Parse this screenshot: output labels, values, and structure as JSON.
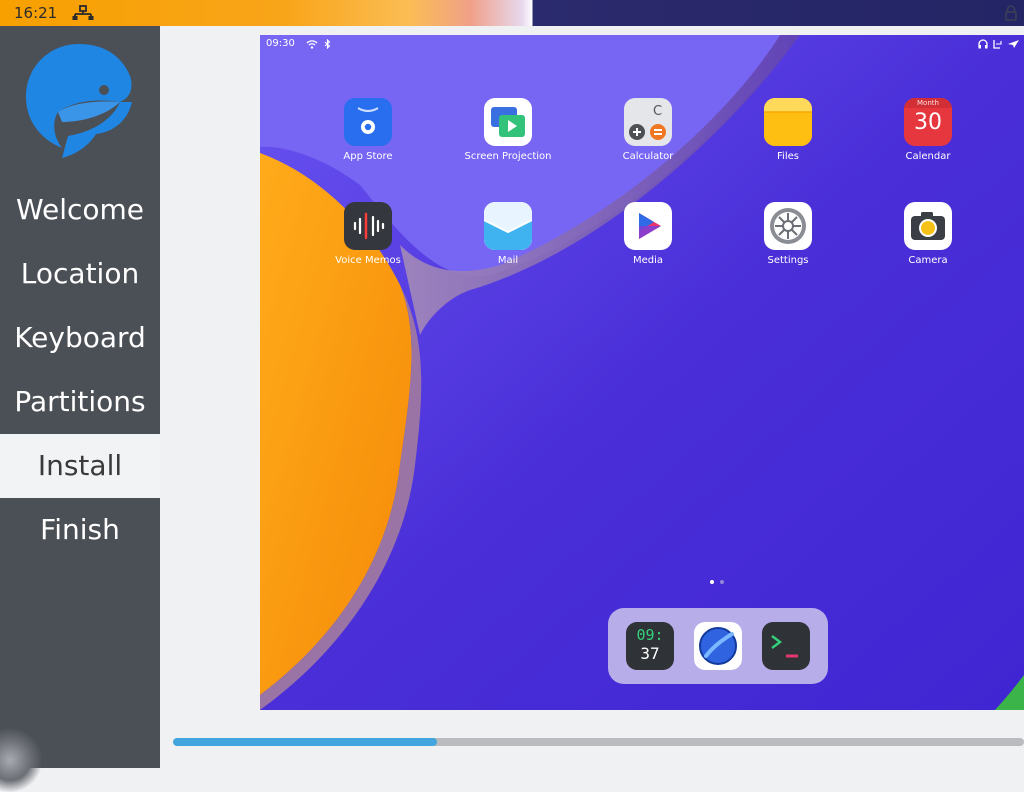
{
  "topbar": {
    "clock": "16:21",
    "network_icon": "network-wired-icon",
    "lock_icon": "lock-icon"
  },
  "sidebar": {
    "logo_icon": "fish-logo-icon",
    "items": [
      {
        "label": "Welcome",
        "active": false
      },
      {
        "label": "Location",
        "active": false
      },
      {
        "label": "Keyboard",
        "active": false
      },
      {
        "label": "Partitions",
        "active": false
      },
      {
        "label": "Install",
        "active": true
      },
      {
        "label": "Finish",
        "active": false
      }
    ]
  },
  "slideshow": {
    "status_time": "09:30",
    "apps": [
      {
        "label": "App Store",
        "icon": "app-store-icon"
      },
      {
        "label": "Screen Projection",
        "icon": "screen-projection-icon"
      },
      {
        "label": "Calculator",
        "icon": "calculator-icon"
      },
      {
        "label": "Files",
        "icon": "files-icon"
      },
      {
        "label": "Calendar",
        "icon": "calendar-icon",
        "month": "Month",
        "day": "30"
      },
      {
        "label": "Voice Memos",
        "icon": "voice-memos-icon"
      },
      {
        "label": "Mail",
        "icon": "mail-icon"
      },
      {
        "label": "Media",
        "icon": "media-icon"
      },
      {
        "label": "Settings",
        "icon": "settings-icon"
      },
      {
        "label": "Camera",
        "icon": "camera-icon"
      }
    ],
    "dock": [
      {
        "icon": "clock-icon",
        "hours": "09:",
        "minutes": "37"
      },
      {
        "icon": "browser-icon"
      },
      {
        "icon": "terminal-icon",
        "prompt": ">_"
      }
    ],
    "page_count": 2,
    "current_page": 1
  },
  "progress": {
    "value": 0.31
  },
  "colors": {
    "sidebar_bg": "#4b4f56",
    "active_item_bg": "#f2f3f5",
    "accent": "#43a5dd",
    "wallpaper_blue": "#4b2fd8",
    "wallpaper_orange": "#f89a0c"
  }
}
